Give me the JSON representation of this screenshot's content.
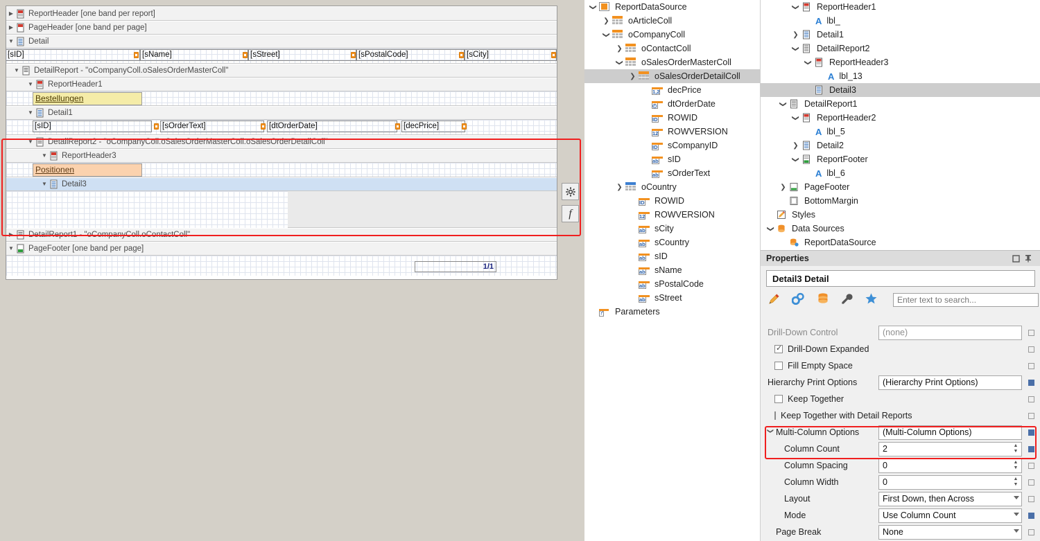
{
  "designer": {
    "bands": [
      {
        "id": "reportheader",
        "label": "ReportHeader [one band per report]",
        "state": "closed"
      },
      {
        "id": "pageheader",
        "label": "PageHeader [one band per page]",
        "state": "closed"
      },
      {
        "id": "detail",
        "label": "Detail",
        "state": "open"
      },
      {
        "id": "detailreport",
        "label": "DetailReport - \"oCompanyColl.oSalesOrderMasterColl\"",
        "state": "open"
      },
      {
        "id": "reportheader1",
        "label": "ReportHeader1",
        "state": "open"
      },
      {
        "id": "detail1",
        "label": "Detail1",
        "state": "open"
      },
      {
        "id": "detailreport2",
        "label": "DetailReport2 - \"oCompanyColl.oSalesOrderMasterColl.oSalesOrderDetailColl\"",
        "state": "open"
      },
      {
        "id": "reportheader3",
        "label": "ReportHeader3",
        "state": "open"
      },
      {
        "id": "detail3",
        "label": "Detail3",
        "state": "open"
      },
      {
        "id": "detailreport1",
        "label": "DetailReport1 - \"oCompanyColl.oContactColl\"",
        "state": "closed"
      },
      {
        "id": "pagefooter",
        "label": "PageFooter [one band per page]",
        "state": "open"
      }
    ],
    "detail_fields": [
      "[sID]",
      "[sName]",
      "[sStreet]",
      "[sPostalCode]",
      "[sCity]"
    ],
    "detail1_fields": [
      "[sID]",
      "[sOrderText]",
      "[dtOrderDate]",
      "[decPrice]"
    ],
    "label_bestellungen": "Bestellungen",
    "label_positionen": "Positionen",
    "page_number": "1/1",
    "side_buttons": [
      "gear-icon",
      "fx-icon"
    ]
  },
  "fieldlist": {
    "nodes": [
      {
        "label": "ReportDataSource",
        "indent": 0,
        "toggle": "down",
        "icon": "datasource-icon",
        "selected": false
      },
      {
        "label": "oArticleColl",
        "indent": 1,
        "toggle": "right",
        "icon": "collection-icon",
        "selected": false
      },
      {
        "label": "oCompanyColl",
        "indent": 1,
        "toggle": "down",
        "icon": "collection-icon",
        "selected": false
      },
      {
        "label": "oContactColl",
        "indent": 2,
        "toggle": "right",
        "icon": "collection-icon",
        "selected": false
      },
      {
        "label": "oSalesOrderMasterColl",
        "indent": 2,
        "toggle": "down",
        "icon": "collection-icon",
        "selected": false
      },
      {
        "label": "oSalesOrderDetailColl",
        "indent": 3,
        "toggle": "right",
        "icon": "collection-icon",
        "selected": true
      },
      {
        "label": "decPrice",
        "indent": 4,
        "toggle": "none",
        "icon": "decimal-field-icon",
        "glyph": "1,2",
        "selected": false
      },
      {
        "label": "dtOrderDate",
        "indent": 4,
        "toggle": "none",
        "icon": "date-field-icon",
        "glyph": "◴",
        "selected": false
      },
      {
        "label": "ROWID",
        "indent": 4,
        "toggle": "none",
        "icon": "id-field-icon",
        "glyph": "ID",
        "selected": false
      },
      {
        "label": "ROWVERSION",
        "indent": 4,
        "toggle": "none",
        "icon": "integer-field-icon",
        "glyph": "12",
        "selected": false
      },
      {
        "label": "sCompanyID",
        "indent": 4,
        "toggle": "none",
        "icon": "id-field-icon",
        "glyph": "ID",
        "selected": false
      },
      {
        "label": "sID",
        "indent": 4,
        "toggle": "none",
        "icon": "string-field-icon",
        "glyph": "ab",
        "selected": false
      },
      {
        "label": "sOrderText",
        "indent": 4,
        "toggle": "none",
        "icon": "string-field-icon",
        "glyph": "ab",
        "selected": false
      },
      {
        "label": "oCountry",
        "indent": 2,
        "toggle": "right",
        "icon": "collection-blue-icon",
        "selected": false
      },
      {
        "label": "ROWID",
        "indent": 3,
        "toggle": "none",
        "icon": "id-field-icon",
        "glyph": "ID",
        "selected": false
      },
      {
        "label": "ROWVERSION",
        "indent": 3,
        "toggle": "none",
        "icon": "integer-field-icon",
        "glyph": "12",
        "selected": false
      },
      {
        "label": "sCity",
        "indent": 3,
        "toggle": "none",
        "icon": "string-field-icon",
        "glyph": "ab",
        "selected": false
      },
      {
        "label": "sCountry",
        "indent": 3,
        "toggle": "none",
        "icon": "string-field-icon",
        "glyph": "ab",
        "selected": false
      },
      {
        "label": "sID",
        "indent": 3,
        "toggle": "none",
        "icon": "string-field-icon",
        "glyph": "ab",
        "selected": false
      },
      {
        "label": "sName",
        "indent": 3,
        "toggle": "none",
        "icon": "string-field-icon",
        "glyph": "ab",
        "selected": false
      },
      {
        "label": "sPostalCode",
        "indent": 3,
        "toggle": "none",
        "icon": "string-field-icon",
        "glyph": "ab",
        "selected": false
      },
      {
        "label": "sStreet",
        "indent": 3,
        "toggle": "none",
        "icon": "string-field-icon",
        "glyph": "ab",
        "selected": false
      },
      {
        "label": "Parameters",
        "indent": 0,
        "toggle": "none",
        "icon": "parameters-icon",
        "glyph": "?",
        "selected": false
      }
    ]
  },
  "explorer": {
    "nodes": [
      {
        "label": "ReportHeader1",
        "indent": 2,
        "toggle": "down",
        "icon": "report-header-band-icon",
        "selected": false
      },
      {
        "label": "lbl_",
        "indent": 3,
        "toggle": "none",
        "icon": "label-icon",
        "selected": false
      },
      {
        "label": "Detail1",
        "indent": 2,
        "toggle": "right",
        "icon": "detail-band-icon",
        "selected": false
      },
      {
        "label": "DetailReport2",
        "indent": 2,
        "toggle": "down",
        "icon": "detail-report-icon",
        "selected": false
      },
      {
        "label": "ReportHeader3",
        "indent": 3,
        "toggle": "down",
        "icon": "report-header-band-icon",
        "selected": false
      },
      {
        "label": "lbl_13",
        "indent": 4,
        "toggle": "none",
        "icon": "label-icon",
        "selected": false
      },
      {
        "label": "Detail3",
        "indent": 3,
        "toggle": "none",
        "icon": "detail-band-icon",
        "selected": true
      },
      {
        "label": "DetailReport1",
        "indent": 1,
        "toggle": "down",
        "icon": "detail-report-icon",
        "selected": false
      },
      {
        "label": "ReportHeader2",
        "indent": 2,
        "toggle": "down",
        "icon": "report-header-band-icon",
        "selected": false
      },
      {
        "label": "lbl_5",
        "indent": 3,
        "toggle": "none",
        "icon": "label-icon",
        "selected": false
      },
      {
        "label": "Detail2",
        "indent": 2,
        "toggle": "right",
        "icon": "detail-band-icon",
        "selected": false
      },
      {
        "label": "ReportFooter",
        "indent": 2,
        "toggle": "down",
        "icon": "report-footer-band-icon",
        "selected": false
      },
      {
        "label": "lbl_6",
        "indent": 3,
        "toggle": "none",
        "icon": "label-icon",
        "selected": false
      },
      {
        "label": "PageFooter",
        "indent": 1,
        "toggle": "right",
        "icon": "page-footer-band-icon",
        "selected": false
      },
      {
        "label": "BottomMargin",
        "indent": 1,
        "toggle": "none",
        "icon": "margin-band-icon",
        "selected": false
      },
      {
        "label": "Styles",
        "indent": 0,
        "toggle": "none",
        "icon": "styles-icon",
        "selected": false
      },
      {
        "label": "Data Sources",
        "indent": 0,
        "toggle": "down",
        "icon": "data-sources-icon",
        "selected": false
      },
      {
        "label": "ReportDataSource",
        "indent": 1,
        "toggle": "none",
        "icon": "datasource-item-icon",
        "selected": false
      }
    ]
  },
  "properties": {
    "title": "Properties",
    "object_name": "Detail3  Detail",
    "search_placeholder": "Enter text to search...",
    "toolbar_icons": [
      "appearance-icon",
      "behavior-icon",
      "data-icon",
      "misc-icon",
      "favorites-icon"
    ],
    "rows": [
      {
        "name": "Drill-Down Control",
        "kind": "text",
        "value": "(none)",
        "label_dim": true,
        "mark": "empty"
      },
      {
        "name": "Drill-Down Expanded",
        "kind": "check",
        "checked": true,
        "value": "",
        "mark": "empty"
      },
      {
        "name": "Fill Empty Space",
        "kind": "check",
        "checked": false,
        "value": "",
        "mark": "empty"
      },
      {
        "name": "Hierarchy Print Options",
        "kind": "text",
        "value": "(Hierarchy Print Options)",
        "mark": "filled"
      },
      {
        "name": "Keep Together",
        "kind": "check",
        "checked": false,
        "value": "",
        "mark": "empty"
      },
      {
        "name": "Keep Together with Detail Reports",
        "kind": "check",
        "checked": false,
        "value": "",
        "mark": "empty"
      },
      {
        "name": "Multi-Column Options",
        "kind": "group",
        "value": "(Multi-Column Options)",
        "mark": "filled",
        "highlight": true
      },
      {
        "name": "Column Count",
        "kind": "spin",
        "value": "2",
        "mark": "filled",
        "indent": true,
        "highlight": true
      },
      {
        "name": "Column Spacing",
        "kind": "spin",
        "value": "0",
        "mark": "empty",
        "indent": true
      },
      {
        "name": "Column Width",
        "kind": "spin",
        "value": "0",
        "mark": "empty",
        "indent": true
      },
      {
        "name": "Layout",
        "kind": "select",
        "value": "First Down, then Across",
        "mark": "empty",
        "indent": true
      },
      {
        "name": "Mode",
        "kind": "select",
        "value": "Use Column Count",
        "mark": "filled",
        "indent": true
      },
      {
        "name": "Page Break",
        "kind": "select",
        "value": "None",
        "mark": "empty",
        "indent2": true
      }
    ]
  },
  "colors": {
    "accent_orange": "#f29120",
    "accent_blue": "#2b7fd4",
    "highlight_red": "#f01f1f",
    "selection_blue": "#cfe0f3",
    "selection_grey": "#cdcdcd",
    "label_yellow": "#f5eca8",
    "label_orange": "#fbd2ae"
  }
}
